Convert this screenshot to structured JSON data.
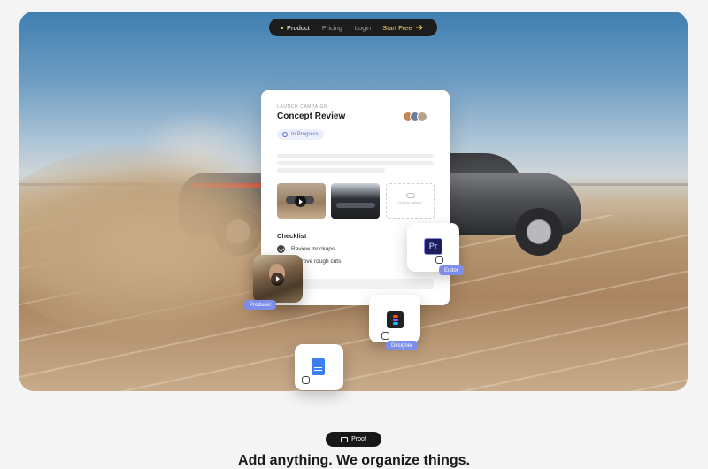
{
  "nav": {
    "items": [
      {
        "label": "Product",
        "active": true
      },
      {
        "label": "Pricing"
      },
      {
        "label": "Login"
      }
    ],
    "cta": "Start Free"
  },
  "card": {
    "kicker": "LAUNCH CAMPAIGN",
    "title": "Concept Review",
    "status": "In Progress",
    "dropzone": "Drag to upload",
    "checklist_title": "Checklist",
    "checklist": [
      {
        "label": "Review mockups",
        "checked": true
      },
      {
        "label": "Approve rough cuts",
        "checked": true
      }
    ]
  },
  "tiles": {
    "producer_label": "Producer",
    "editor_label": "Editor",
    "editor_app": "Pr",
    "designer_label": "Designer"
  },
  "section": {
    "pill": "Proof",
    "headline": "Add anything. We organize things."
  },
  "colors": {
    "accent": "#f1d35a",
    "badge": "#7d8de8",
    "status_bg": "#edf0fb",
    "status_text": "#5a6fcc"
  }
}
